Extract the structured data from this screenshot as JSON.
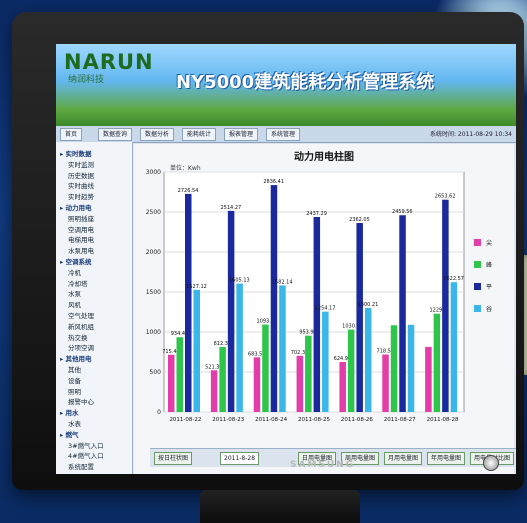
{
  "header": {
    "logo": "NARUN",
    "logo_sub": "纳润科技",
    "system_title": "NY5000建筑能耗分析管理系统"
  },
  "tabs": [
    "首页",
    "数据查询",
    "数据分析",
    "能耗统计",
    "报表管理",
    "系统管理"
  ],
  "date_text": "系统时间: 2011-08-29 10:34",
  "sidebar": [
    {
      "label": "实时数据",
      "group": true
    },
    {
      "label": "实时监测",
      "group": false
    },
    {
      "label": "历史数据",
      "group": false
    },
    {
      "label": "实时曲线",
      "group": false
    },
    {
      "label": "实时趋势",
      "group": false
    },
    {
      "label": "动力用电",
      "group": true
    },
    {
      "label": "照明插座",
      "group": false
    },
    {
      "label": "空调用电",
      "group": false
    },
    {
      "label": "电梯用电",
      "group": false
    },
    {
      "label": "水泵用电",
      "group": false
    },
    {
      "label": "空调系统",
      "group": true
    },
    {
      "label": "冷机",
      "group": false
    },
    {
      "label": "冷却塔",
      "group": false
    },
    {
      "label": "水泵",
      "group": false
    },
    {
      "label": "风机",
      "group": false
    },
    {
      "label": "空气处理",
      "group": false
    },
    {
      "label": "新风机组",
      "group": false
    },
    {
      "label": "热交换",
      "group": false
    },
    {
      "label": "分项空调",
      "group": false
    },
    {
      "label": "其他用电",
      "group": true
    },
    {
      "label": "其他",
      "group": false
    },
    {
      "label": "设备",
      "group": false
    },
    {
      "label": "照明",
      "group": false
    },
    {
      "label": "报警中心",
      "group": false
    },
    {
      "label": "用水",
      "group": true
    },
    {
      "label": "水表",
      "group": false
    },
    {
      "label": "燃气",
      "group": true
    },
    {
      "label": "3#燃气入口",
      "group": false
    },
    {
      "label": "4#燃气入口",
      "group": false
    },
    {
      "label": "系统配置",
      "group": false
    }
  ],
  "footer": {
    "select_label": "按日柱状图",
    "date_value": "2011-8-28",
    "buttons": [
      "日用电量图",
      "周用电量图",
      "月用电量图",
      "年用电量图",
      "用电量对比图"
    ]
  },
  "monitor": {
    "brand": "SAMSUNG"
  },
  "colors": {
    "s1": "#e23da8",
    "s2": "#2fc54b",
    "s3": "#1a2a9c",
    "s4": "#3ab6e8"
  },
  "chart_data": {
    "type": "bar",
    "title": "动力用电柱图",
    "ylabel": "单位：Kwh",
    "ylim": [
      0,
      3000
    ],
    "yticks": [
      0,
      500,
      1000,
      1500,
      2000,
      2500,
      3000
    ],
    "categories": [
      "2011-08-22",
      "2011-08-23",
      "2011-08-24",
      "2011-08-25",
      "2011-08-26",
      "2011-08-27",
      "2011-08-28"
    ],
    "series": [
      {
        "name": "尖",
        "values": [
          715.4,
          521.3,
          683.2,
          702.3,
          624.9,
          718.5,
          814.0
        ],
        "labels": [
          "715.40",
          "521.32",
          "683.53",
          "702.33",
          "624.92",
          "718.53",
          ""
        ]
      },
      {
        "name": "峰",
        "values": [
          934.4,
          812.3,
          1093.1,
          953.9,
          1030.0,
          1084.0,
          1229.0
        ],
        "labels": [
          "934.40",
          "812.36",
          "1093.1",
          "953.92",
          "1030.0",
          "",
          "1229."
        ]
      },
      {
        "name": "平",
        "values": [
          2726.54,
          2514.27,
          2836.41,
          2437.29,
          2362.05,
          2459.56,
          2653.62
        ],
        "labels": [
          "2726.54",
          "2514.27",
          "2836.41",
          "2437.29",
          "2362.05",
          "2459.56",
          "2653.62"
        ]
      },
      {
        "name": "谷",
        "values": [
          1527.1,
          1605.13,
          1582.14,
          1254.17,
          1300.21,
          1090.0,
          1622.57
        ],
        "labels": [
          "1527.12",
          "1605.13",
          "1582.14",
          "1254.17",
          "1300.21",
          "",
          "1622.57"
        ]
      }
    ],
    "legend_position": "right"
  }
}
